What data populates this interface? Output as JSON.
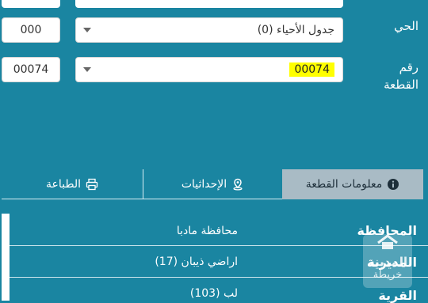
{
  "fields": {
    "district": {
      "label": "الحي",
      "code": "000",
      "select_value": "جدول الأحياء (0)"
    },
    "parcel": {
      "label_line1": "رقم",
      "label_line2": "القطعة",
      "code": "00074",
      "select_value": "00074"
    }
  },
  "tabs": [
    {
      "label": "معلومات القطعة",
      "icon": "info-icon",
      "active": true
    },
    {
      "label": "الإحداثيات",
      "icon": "map-pin-icon",
      "active": false
    },
    {
      "label": "الطباعة",
      "icon": "printer-icon",
      "active": false
    }
  ],
  "info_rows": [
    {
      "label": "المحافظة",
      "value": "محافظة مادبا"
    },
    {
      "label": "المديرية",
      "value": "اراضي ذيبان (17)"
    },
    {
      "label": "القرية",
      "value": "لب (103)"
    }
  ],
  "watermark": {
    "line1": "المدينة",
    "line2": "خريطة",
    "icon": "home-icon"
  },
  "colors": {
    "background": "#1a85a1",
    "active_tab": "#a9bbc5",
    "highlight": "#ffff00"
  }
}
